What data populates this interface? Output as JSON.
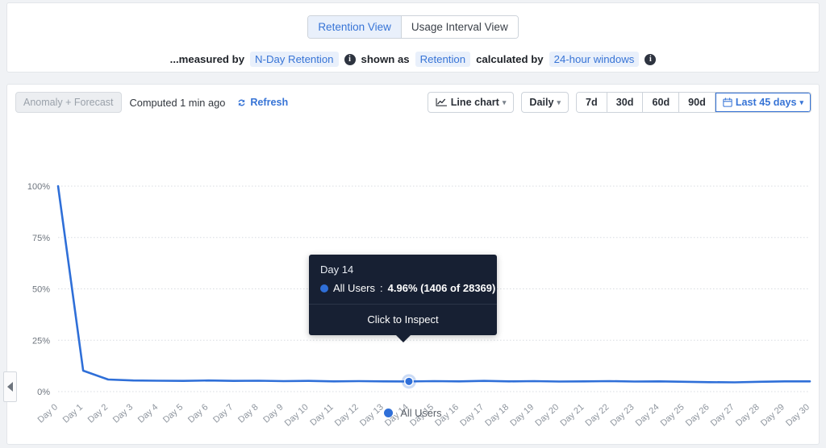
{
  "view_tabs": [
    {
      "label": "Retention View",
      "active": true
    },
    {
      "label": "Usage Interval View",
      "active": false
    }
  ],
  "measure_bar": {
    "prefix": "...measured by",
    "metric": "N-Day Retention",
    "info_icon_1": "info-icon",
    "shown_as_label": "shown as",
    "shown_as_value": "Retention",
    "calculated_by_label": "calculated by",
    "calculated_by_value": "24-hour windows",
    "info_icon_2": "info-icon"
  },
  "toolbar": {
    "anomaly_label": "Anomaly + Forecast",
    "computed_label": "Computed 1 min ago",
    "refresh_label": "Refresh",
    "refresh_icon": "refresh-icon",
    "chart_type": "Line chart",
    "chart_type_icon": "line-chart-icon",
    "granularity": "Daily",
    "ranges": [
      "7d",
      "30d",
      "60d",
      "90d"
    ],
    "date_range": "Last 45 days",
    "calendar_icon": "calendar-icon",
    "caret": "⌄"
  },
  "tooltip": {
    "title": "Day 14",
    "series_name": "All Users",
    "separator": ":",
    "value": "4.96% (1406 of 28369)",
    "action": "Click to Inspect"
  },
  "legend": [
    {
      "label": "All Users",
      "color": "#2f6fd8"
    }
  ],
  "colors": {
    "accent": "#3774d6",
    "line": "#2f6fd8",
    "chip_bg": "#e9f0fb",
    "tooltip_bg": "#172033",
    "panel_bg": "#ffffff",
    "page_bg": "#f0f2f5"
  },
  "collapse_handle": {
    "icon": "chevron-left-icon"
  },
  "chart_data": {
    "type": "line",
    "title": "",
    "xlabel": "",
    "ylabel": "",
    "ylim": [
      0,
      100
    ],
    "yticks": [
      "0%",
      "25%",
      "50%",
      "75%",
      "100%"
    ],
    "ytick_values": [
      0,
      25,
      50,
      75,
      100
    ],
    "grid": true,
    "legend_position": "bottom",
    "categories": [
      "Day 0",
      "Day 1",
      "Day 2",
      "Day 3",
      "Day 4",
      "Day 5",
      "Day 6",
      "Day 7",
      "Day 8",
      "Day 9",
      "Day 10",
      "Day 11",
      "Day 12",
      "Day 13",
      "Day 14",
      "Day 15",
      "Day 16",
      "Day 17",
      "Day 18",
      "Day 19",
      "Day 20",
      "Day 21",
      "Day 22",
      "Day 23",
      "Day 24",
      "Day 25",
      "Day 26",
      "Day 27",
      "Day 28",
      "Day 29",
      "Day 30"
    ],
    "series": [
      {
        "name": "All Users",
        "color": "#2f6fd8",
        "values": [
          100,
          10.2,
          5.9,
          5.4,
          5.3,
          5.2,
          5.4,
          5.2,
          5.3,
          5.1,
          5.2,
          5.0,
          5.1,
          5.0,
          4.96,
          5.1,
          5.0,
          5.2,
          5.0,
          5.1,
          4.9,
          5.0,
          5.1,
          4.9,
          5.0,
          4.8,
          4.6,
          4.5,
          4.8,
          5.0,
          5.0
        ]
      }
    ],
    "highlighted_point": {
      "category": "Day 14",
      "value": 4.96,
      "index": 14
    }
  }
}
